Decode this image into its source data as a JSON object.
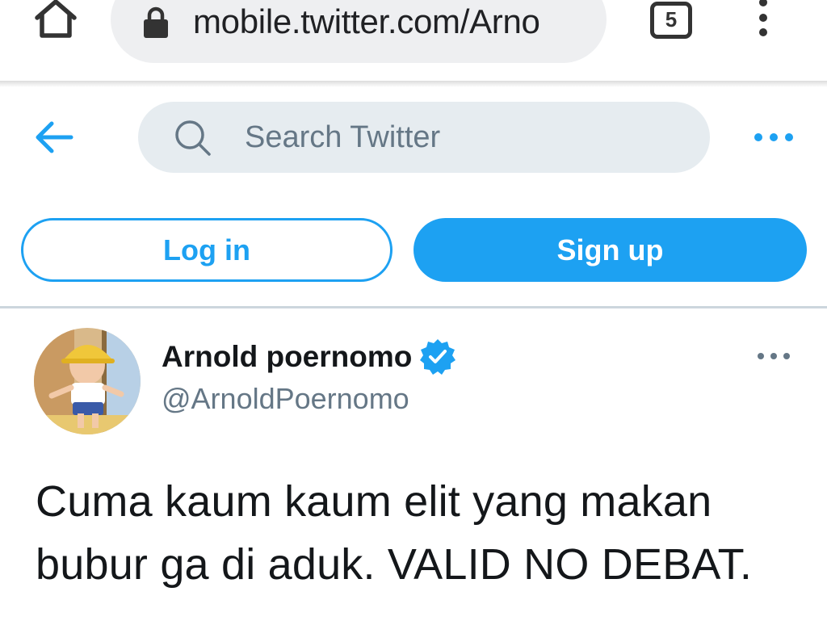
{
  "browser": {
    "url": "mobile.twitter.com/Arno",
    "tab_count": "5"
  },
  "header": {
    "search_placeholder": "Search Twitter"
  },
  "auth": {
    "login_label": "Log in",
    "signup_label": "Sign up"
  },
  "tweet": {
    "display_name": "Arnold poernomo",
    "username": "@ArnoldPoernomo",
    "text": "Cuma kaum kaum elit yang makan bubur ga di aduk. VALID NO DEBAT."
  },
  "colors": {
    "accent": "#1da1f2",
    "secondary_text": "#657786",
    "search_bg": "#e6ecf0",
    "divider": "#ccd6dd"
  },
  "icons": {
    "home": "home-icon",
    "lock": "lock-icon",
    "menu": "vertical-dots-icon",
    "back": "arrow-left-icon",
    "search": "search-icon",
    "more": "horizontal-dots-icon",
    "verified": "verified-badge-icon"
  }
}
